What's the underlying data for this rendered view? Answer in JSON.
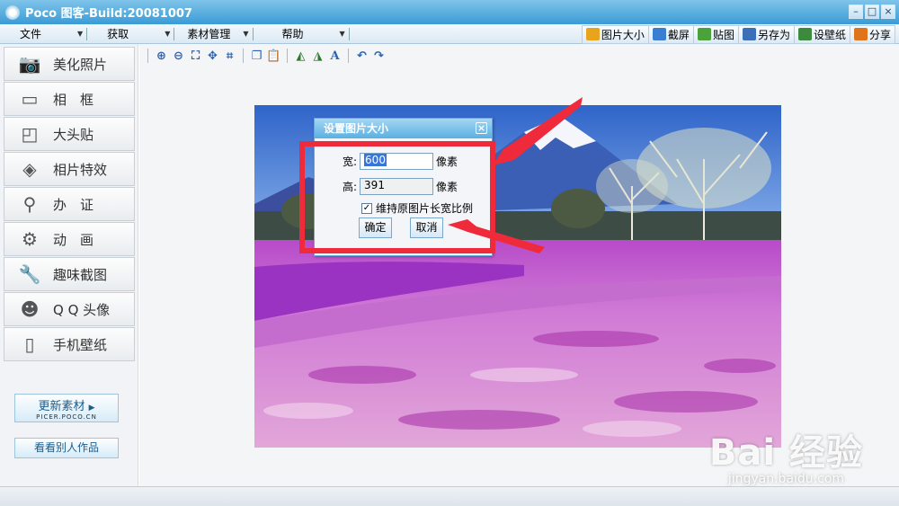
{
  "window": {
    "title": "Poco 图客-Build:20081007",
    "controls": [
      "minimize",
      "restore",
      "close"
    ]
  },
  "menu": [
    {
      "label": "文件"
    },
    {
      "label": "获取"
    },
    {
      "label": "素材管理"
    },
    {
      "label": "帮助"
    }
  ],
  "toolbar": {
    "buttons": [
      {
        "label": "图片大小",
        "icon": "resize-icon",
        "color": "#e8a41d"
      },
      {
        "label": "截屏",
        "icon": "screenshot-icon",
        "color": "#3a7ed1"
      },
      {
        "label": "贴图",
        "icon": "paste-image-icon",
        "color": "#4aa23b"
      },
      {
        "label": "另存为",
        "icon": "save-as-icon",
        "color": "#3b6fb8"
      },
      {
        "label": "设壁纸",
        "icon": "wallpaper-icon",
        "color": "#3c8a3c"
      },
      {
        "label": "分享",
        "icon": "share-icon",
        "color": "#e0741c"
      }
    ]
  },
  "icon_toolbar": [
    "zoom-in-icon",
    "zoom-out-icon",
    "fit-window-icon",
    "actual-size-icon",
    "crop-icon",
    "copy-icon",
    "paste-icon",
    "flip-horizontal-icon",
    "flip-vertical-icon",
    "text-icon",
    "undo-icon",
    "redo-icon"
  ],
  "sidebar": {
    "items": [
      {
        "label": "美化照片",
        "icon": "camera-icon"
      },
      {
        "label": "相　框",
        "icon": "frame-icon"
      },
      {
        "label": "大头贴",
        "icon": "sticker-icon"
      },
      {
        "label": "相片特效",
        "icon": "effects-icon"
      },
      {
        "label": "办　证",
        "icon": "stamp-icon"
      },
      {
        "label": "动　画",
        "icon": "gears-icon"
      },
      {
        "label": "趣味截图",
        "icon": "wrench-icon"
      },
      {
        "label": "Q Q 头像",
        "icon": "smiley-icon"
      },
      {
        "label": "手机壁纸",
        "icon": "phone-icon"
      }
    ],
    "update_link": {
      "label": "更新素材",
      "sub": "PICER.POCO.CN"
    },
    "gallery_link": {
      "label": "看看别人作品"
    }
  },
  "dialog": {
    "title": "设置图片大小",
    "width_label": "宽:",
    "width_value": "600",
    "height_label": "高:",
    "height_value": "391",
    "unit": "像素",
    "keep_ratio_label": "维持原图片长宽比例",
    "keep_ratio_checked": true,
    "ok_label": "确定",
    "cancel_label": "取消"
  },
  "watermark": {
    "brand": "Bai 经验",
    "url": "jingyan.baidu.com"
  },
  "colors": {
    "title_bar": "#3a9bd6",
    "annotation_red": "#ef2a3a",
    "dialog_title": "#5ab0e3"
  }
}
